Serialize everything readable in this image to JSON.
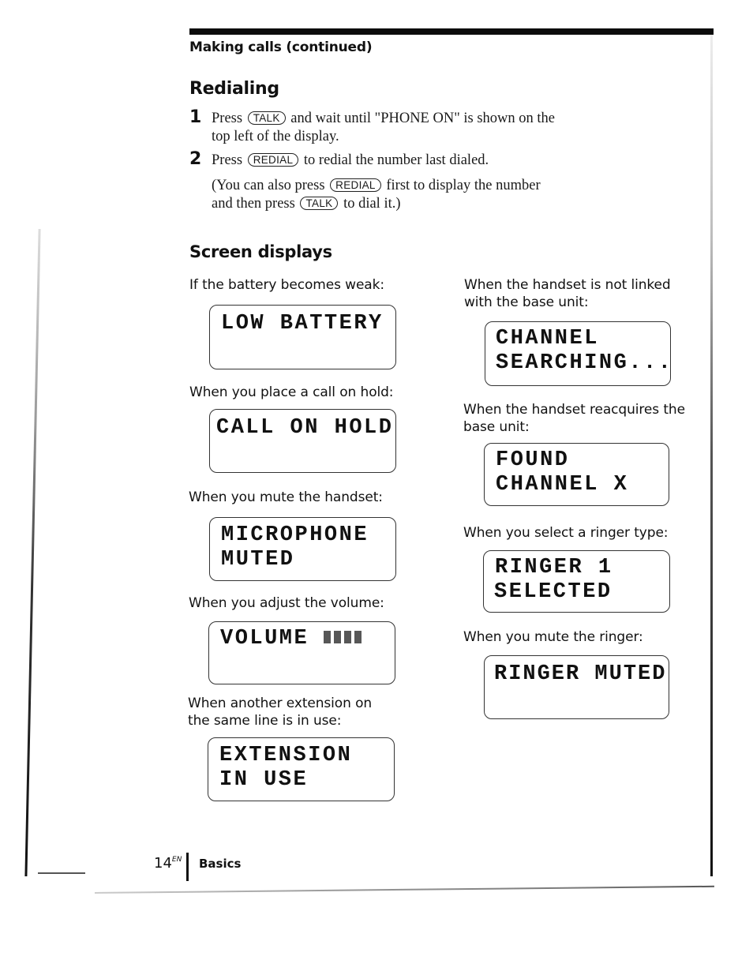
{
  "header": {
    "running_head": "Making calls (continued)"
  },
  "redialing": {
    "title": "Redialing",
    "steps": [
      {
        "number": "1",
        "pre": "Press",
        "key": "TALK",
        "post_line1": "and wait until \"PHONE ON\" is shown on the",
        "line2": "top left of the display."
      },
      {
        "number": "2",
        "pre": "Press",
        "key": "REDIAL",
        "post_line1": "to redial the number last dialed."
      }
    ],
    "note": {
      "pre": "(You can also press",
      "key1": "REDIAL",
      "mid": "first to display the number",
      "line2_pre": "and then press",
      "key2": "TALK",
      "line2_post": "to dial it.)"
    }
  },
  "screen_displays": {
    "title": "Screen displays",
    "left": [
      {
        "caption": [
          "If the battery becomes weak:"
        ],
        "lcd": [
          "LOW BATTERY"
        ]
      },
      {
        "caption": [
          "When you place a call on hold:"
        ],
        "lcd": [
          "CALL ON HOLD"
        ]
      },
      {
        "caption": [
          "When you mute the handset:"
        ],
        "lcd": [
          "MICROPHONE",
          "MUTED"
        ]
      },
      {
        "caption": [
          "When you adjust the volume:"
        ],
        "lcd": [
          "VOLUME"
        ],
        "volume_level_bars": 4
      },
      {
        "caption": [
          "When another extension on",
          "the same line is in use:"
        ],
        "lcd": [
          "EXTENSION",
          "IN USE"
        ]
      }
    ],
    "right": [
      {
        "caption": [
          "When the handset is not linked",
          "with the base unit:"
        ],
        "lcd": [
          "CHANNEL",
          "SEARCHING..."
        ]
      },
      {
        "caption": [
          "When the handset reacquires the",
          "base unit:"
        ],
        "lcd": [
          "FOUND",
          "CHANNEL X"
        ]
      },
      {
        "caption": [
          "When you select a ringer type:"
        ],
        "lcd": [
          "RINGER 1",
          "SELECTED"
        ]
      },
      {
        "caption": [
          "When you mute the ringer:"
        ],
        "lcd": [
          "RINGER MUTED"
        ]
      }
    ]
  },
  "footer": {
    "page_number": "14",
    "page_suffix": "EN",
    "section": "Basics"
  }
}
